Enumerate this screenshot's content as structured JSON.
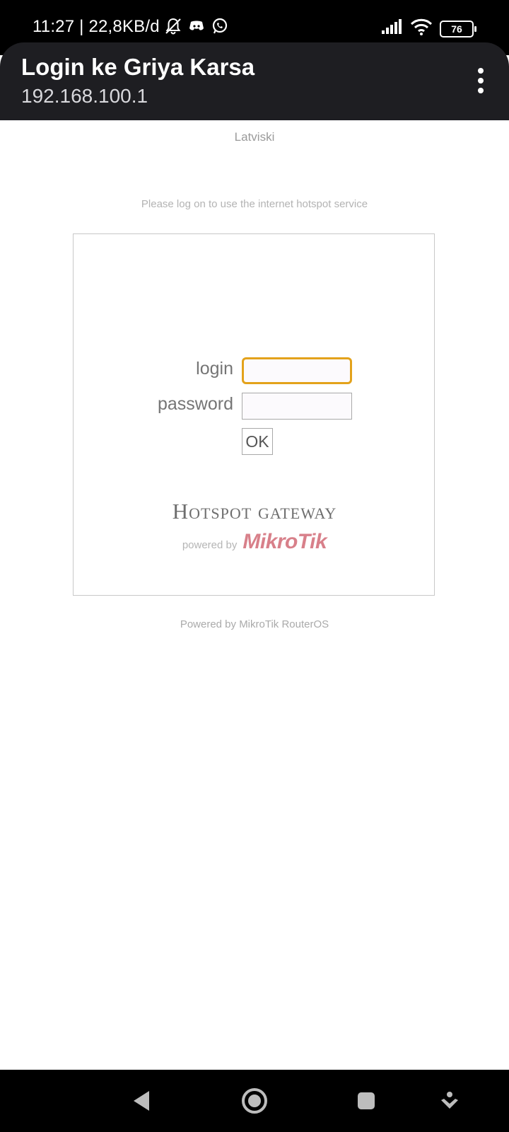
{
  "status_bar": {
    "time_speed": "11:27 | 22,8KB/d",
    "battery": "76",
    "icons": [
      "bell-off-icon",
      "discord-icon",
      "whatsapp-icon",
      "signal-icon",
      "wifi-icon",
      "battery-icon"
    ]
  },
  "app_bar": {
    "title": "Login ke Griya Karsa",
    "subtitle": "192.168.100.1",
    "menu_icon": "more-vert-icon"
  },
  "page": {
    "language_link": "Latviski",
    "notice": "Please log on to use the internet hotspot service",
    "form": {
      "login_label": "login",
      "login_value": "",
      "password_label": "password",
      "password_value": "",
      "submit_label": "OK"
    },
    "logo": {
      "title": "Hotspot gateway",
      "powered_by": "powered by",
      "brand": "MikroTik"
    },
    "footer": "Powered by MikroTik RouterOS"
  },
  "nav_bar": {
    "icons": [
      "back-icon",
      "home-icon",
      "recents-icon",
      "assistant-icon"
    ]
  },
  "colors": {
    "app_bar": "#1e1e22",
    "focus_border": "#e3a21b",
    "brand": "#d8808a"
  }
}
